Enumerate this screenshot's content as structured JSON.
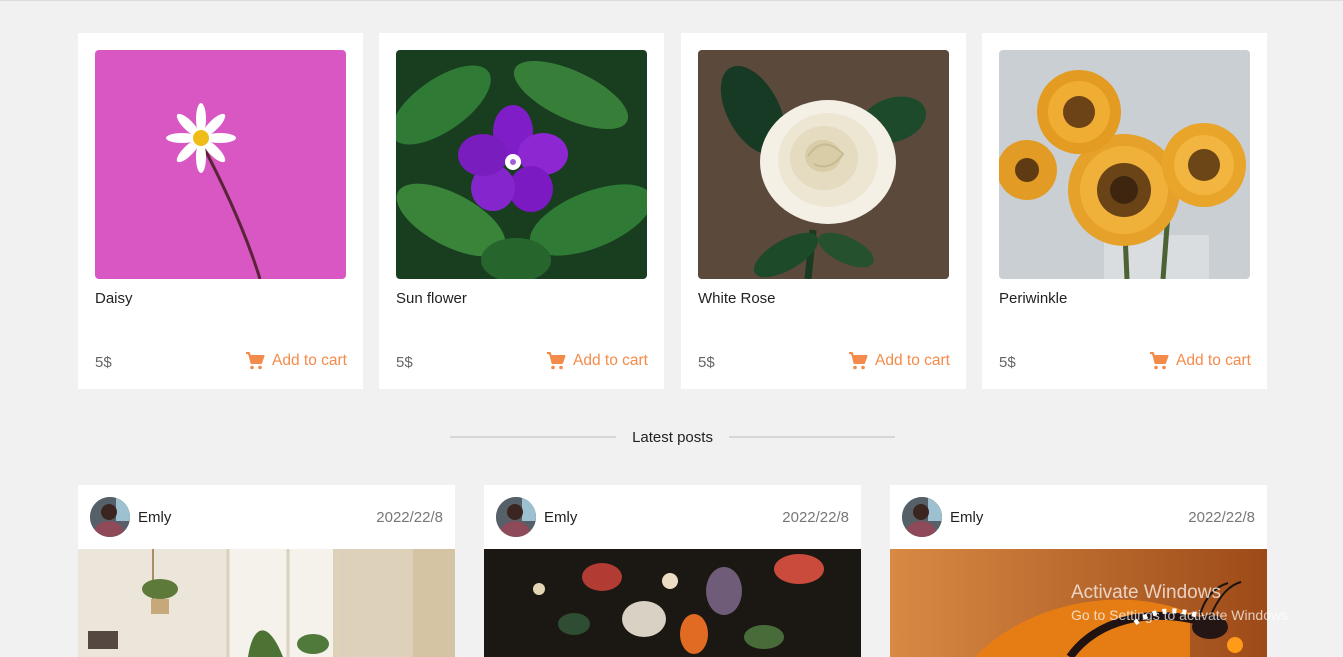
{
  "products": [
    {
      "name": "Daisy",
      "price": "5$",
      "cta": "Add to cart",
      "image_icon": "daisy-photo"
    },
    {
      "name": "Sun flower",
      "price": "5$",
      "cta": "Add to cart",
      "image_icon": "periwinkle-photo"
    },
    {
      "name": "White Rose",
      "price": "5$",
      "cta": "Add to cart",
      "image_icon": "white-rose-photo"
    },
    {
      "name": "Periwinkle",
      "price": "5$",
      "cta": "Add to cart",
      "image_icon": "sunflower-photo"
    }
  ],
  "section": {
    "latest_posts_title": "Latest posts"
  },
  "posts": [
    {
      "author": "Emly",
      "date": "2022/22/8",
      "image_icon": "room-plants-photo"
    },
    {
      "author": "Emly",
      "date": "2022/22/8",
      "image_icon": "flower-painting-photo"
    },
    {
      "author": "Emly",
      "date": "2022/22/8",
      "image_icon": "butterfly-photo"
    }
  ],
  "watermark": {
    "title": "Activate Windows",
    "subtitle": "Go to Settings to activate Windows."
  },
  "colors": {
    "accent": "#f48b4a",
    "page_background": "#f1f1f1",
    "card_background": "#ffffff"
  }
}
